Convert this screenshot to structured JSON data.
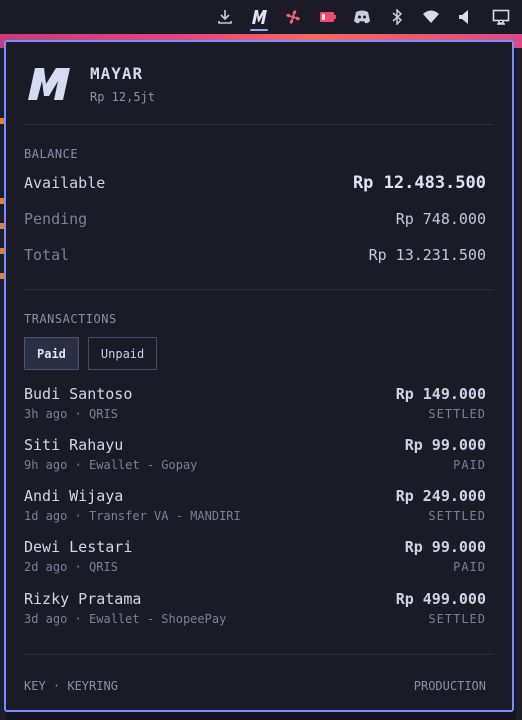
{
  "tray": {
    "icons": [
      "download-icon",
      "mayar-icon",
      "fan-icon",
      "battery-low-icon",
      "discord-icon",
      "bluetooth-icon",
      "wifi-icon",
      "volume-icon",
      "display-icon"
    ]
  },
  "colors": {
    "accent": "#7a8dff",
    "panel_bg": "#1a1b26"
  },
  "header": {
    "logo_text": "M",
    "title": "MAYAR",
    "subtitle": "Rp 12,5jt"
  },
  "balance": {
    "section_title": "BALANCE",
    "rows": [
      {
        "label": "Available",
        "amount": "Rp 12.483.500"
      },
      {
        "label": "Pending",
        "amount": "Rp 748.000"
      },
      {
        "label": "Total",
        "amount": "Rp 13.231.500"
      }
    ]
  },
  "transactions": {
    "section_title": "TRANSACTIONS",
    "tabs": [
      {
        "label": "Paid",
        "active": true
      },
      {
        "label": "Unpaid",
        "active": false
      }
    ],
    "items": [
      {
        "name": "Budi Santoso",
        "meta": "3h ago · QRIS",
        "amount": "Rp 149.000",
        "status": "SETTLED"
      },
      {
        "name": "Siti Rahayu",
        "meta": "9h ago · Ewallet - Gopay",
        "amount": "Rp 99.000",
        "status": "PAID"
      },
      {
        "name": "Andi Wijaya",
        "meta": "1d ago · Transfer VA - MANDIRI",
        "amount": "Rp 249.000",
        "status": "SETTLED"
      },
      {
        "name": "Dewi Lestari",
        "meta": "2d ago · QRIS",
        "amount": "Rp 99.000",
        "status": "PAID"
      },
      {
        "name": "Rizky Pratama",
        "meta": "3d ago · Ewallet - ShopeePay",
        "amount": "Rp 499.000",
        "status": "SETTLED"
      }
    ]
  },
  "footer": {
    "key_source": "KEY · KEYRING",
    "environment": "PRODUCTION"
  }
}
